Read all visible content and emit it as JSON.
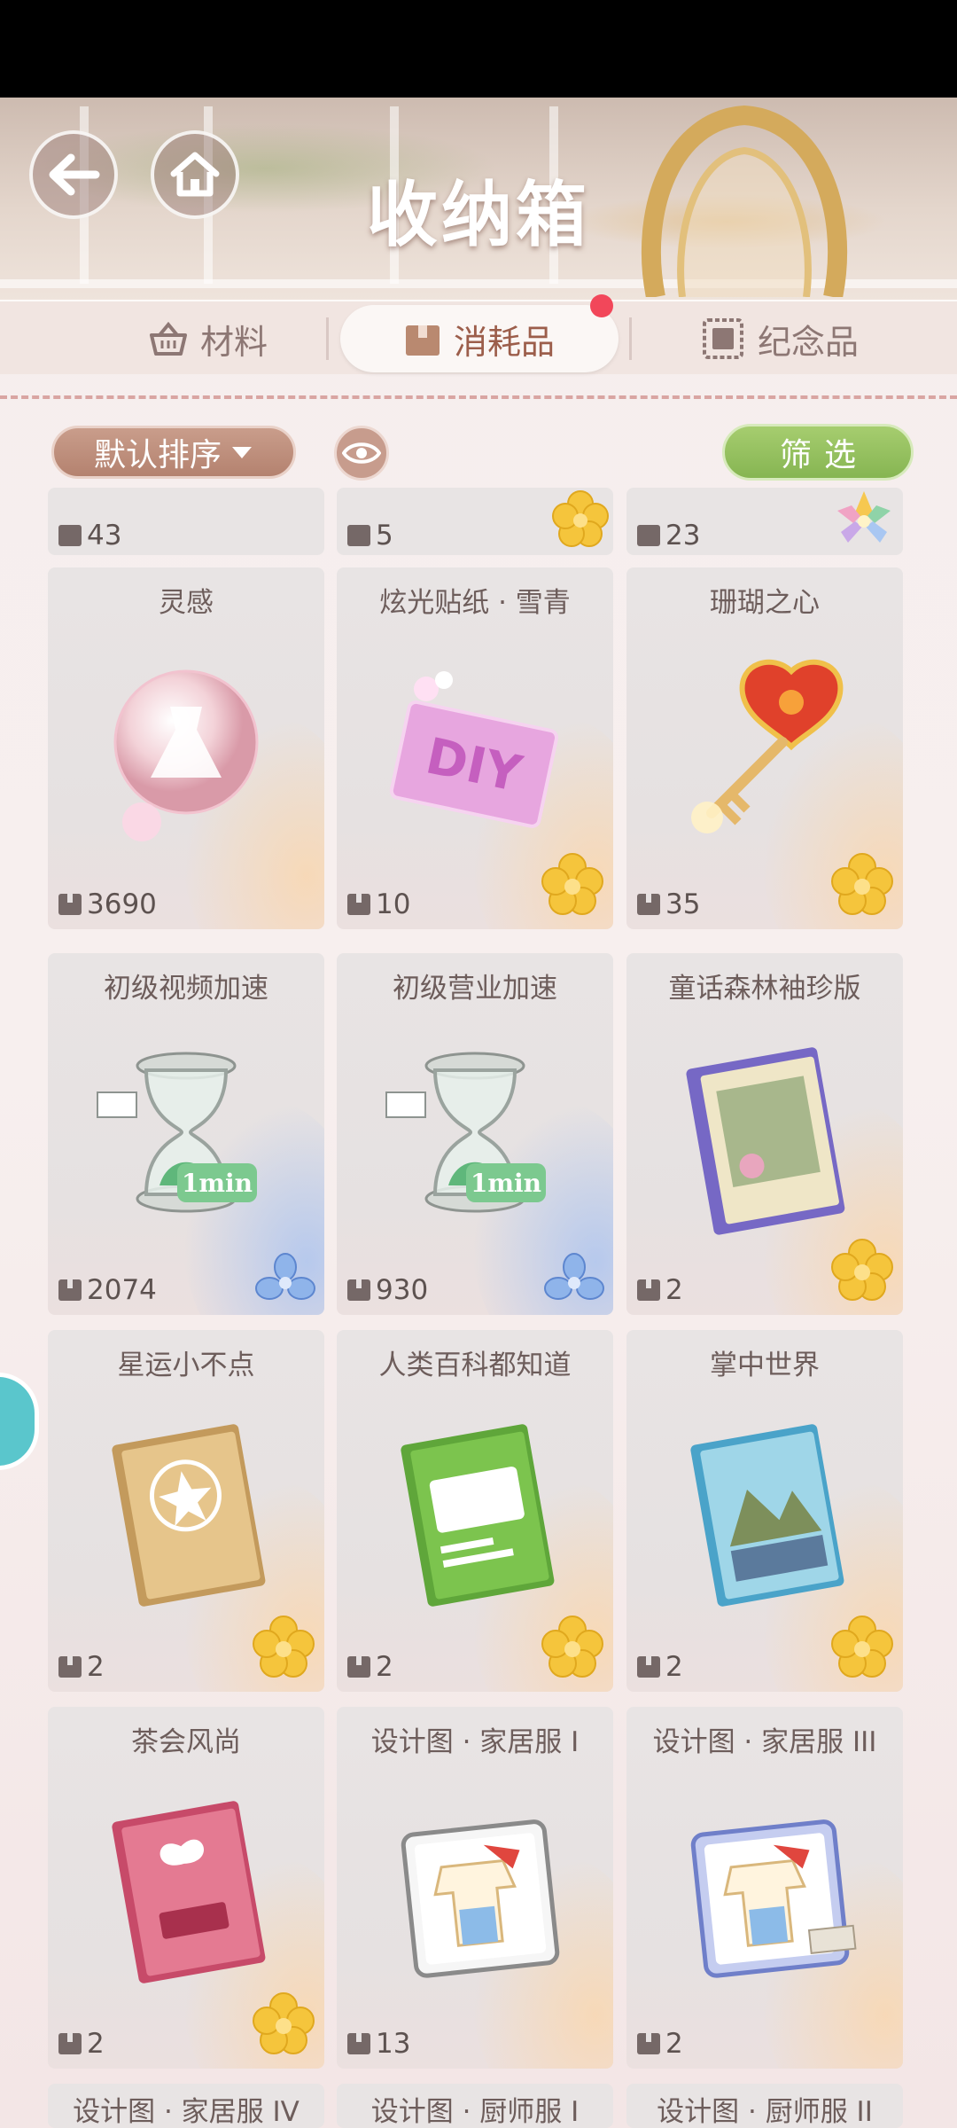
{
  "header": {
    "title": "收纳箱"
  },
  "tabs": [
    {
      "label": "材料",
      "icon": "basket-icon"
    },
    {
      "label": "消耗品",
      "icon": "box-icon"
    },
    {
      "label": "纪念品",
      "icon": "stamp-icon"
    }
  ],
  "toolbar": {
    "sort_label": "默认排序",
    "filter_label": "筛选"
  },
  "partial_top": [
    {
      "count": "43"
    },
    {
      "count": "5",
      "badge": "star"
    },
    {
      "count": "23",
      "badge": "gem-flower"
    }
  ],
  "items": [
    {
      "name": "灵感",
      "count": "3690",
      "art": "pink-orb",
      "badge": ""
    },
    {
      "name": "炫光贴纸 · 雪青",
      "count": "10",
      "art": "diy-sticker",
      "badge": "star"
    },
    {
      "name": "珊瑚之心",
      "count": "35",
      "art": "heart-key",
      "badge": "star"
    },
    {
      "name": "初级视频加速",
      "count": "2074",
      "art": "hourglass",
      "badge": "blue-flower"
    },
    {
      "name": "初级营业加速",
      "count": "930",
      "art": "hourglass",
      "badge": "blue-flower"
    },
    {
      "name": "童话森林袖珍版",
      "count": "2",
      "art": "purple-book",
      "badge": "star"
    },
    {
      "name": "星运小不点",
      "count": "2",
      "art": "gold-book",
      "badge": "star"
    },
    {
      "name": "人类百科都知道",
      "count": "2",
      "art": "green-book",
      "badge": "star"
    },
    {
      "name": "掌中世界",
      "count": "2",
      "art": "blue-book",
      "badge": "star"
    },
    {
      "name": "茶会风尚",
      "count": "2",
      "art": "pink-book",
      "badge": "star"
    },
    {
      "name": "设计图 · 家居服 I",
      "count": "13",
      "art": "blueprint",
      "badge": ""
    },
    {
      "name": "设计图 · 家居服 III",
      "count": "2",
      "art": "blueprint-blue",
      "badge": ""
    }
  ],
  "partial_bottom": [
    {
      "name": "设计图 · 家居服 IV"
    },
    {
      "name": "设计图 · 厨师服 I"
    },
    {
      "name": "设计图 · 厨师服 II"
    }
  ],
  "art_text": {
    "hourglass_label": "1min",
    "sticker_label": "DIY"
  }
}
